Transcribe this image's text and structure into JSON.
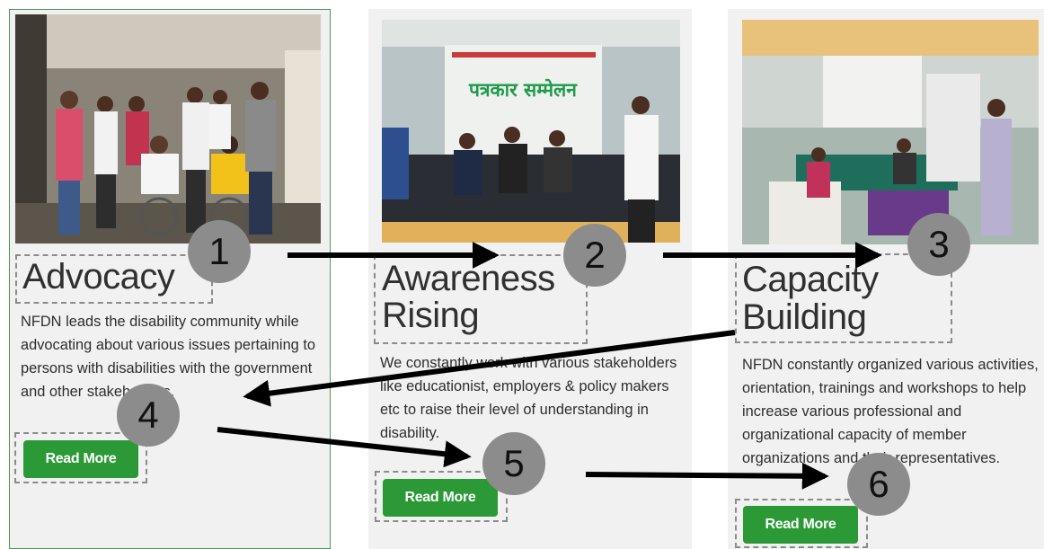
{
  "cards": [
    {
      "title": "Advocacy",
      "body": "NFDN leads the disability community while advocating about various issues pertaining to persons with disabilities with the government and other stakeholders.",
      "button": "Read More"
    },
    {
      "title_line1": "Awareness",
      "title_line2": "Rising",
      "body": "We constantly work with various stakeholders like educationist, employers & policy makers etc to raise their level of understanding in disability.",
      "button": "Read More",
      "photo_banner": "पत्रकार सम्मेलन"
    },
    {
      "title_line1": "Capacity",
      "title_line2": "Building",
      "body": "NFDN constantly organized various activities, orientation, trainings and workshops to help increase various professional and organizational capacity of member organizations and their representatives.",
      "button": "Read More"
    }
  ],
  "markers": [
    "1",
    "2",
    "3",
    "4",
    "5",
    "6"
  ],
  "colors": {
    "button": "#2b9a36",
    "marker": "#8c8c8c",
    "highlight": "#8b8b8b",
    "card_bg": "#f1f1f1"
  }
}
